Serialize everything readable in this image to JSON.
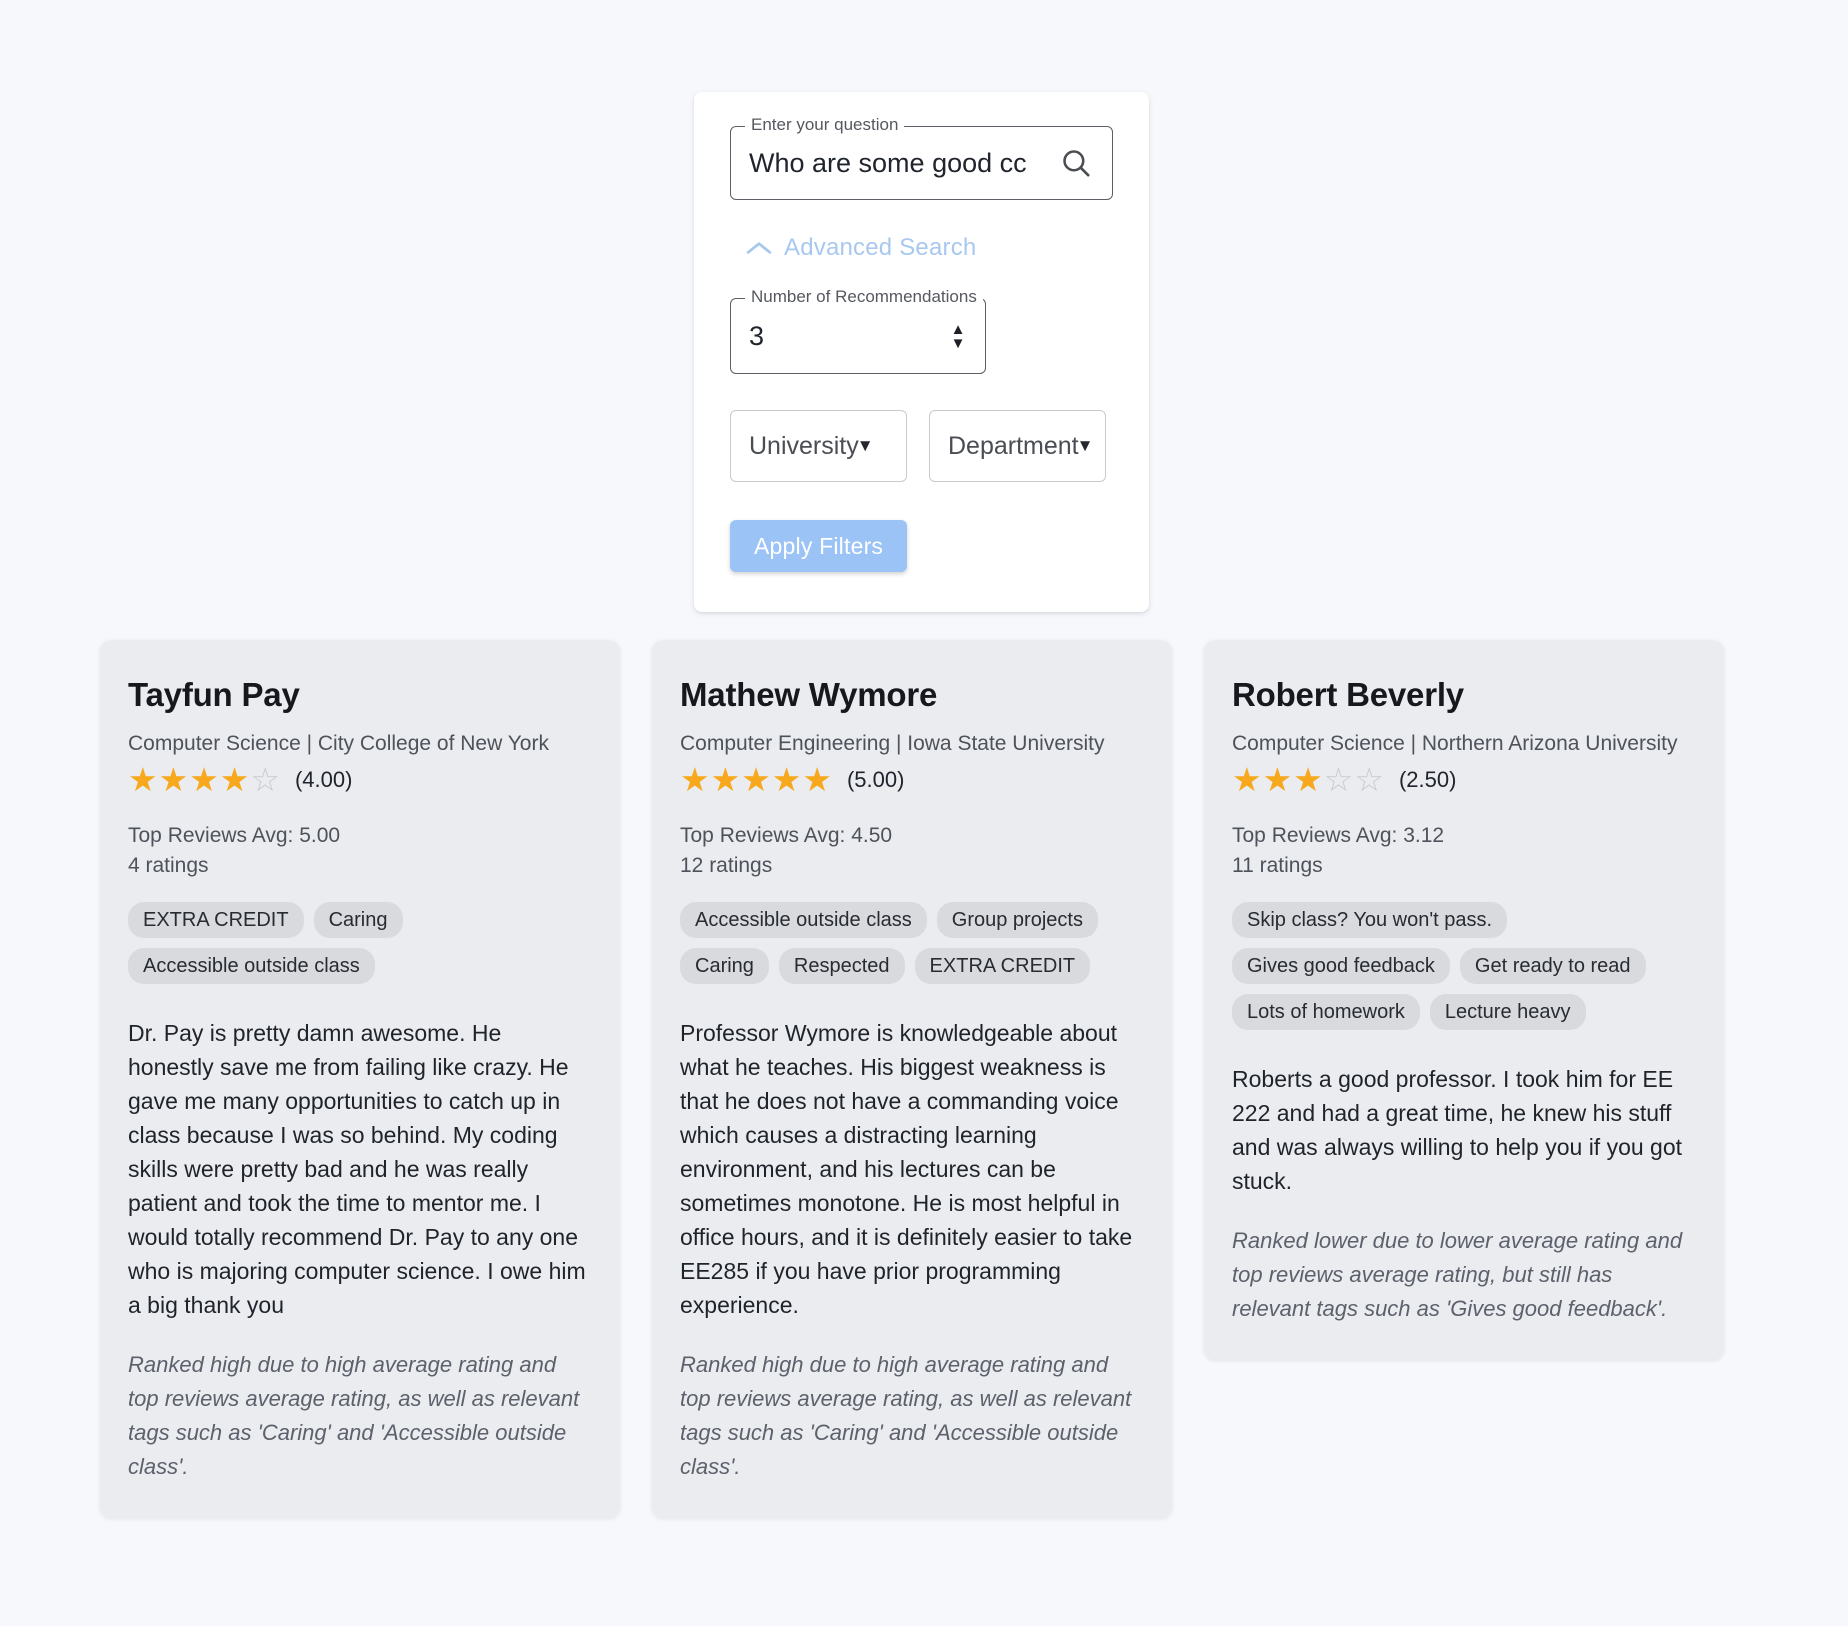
{
  "search": {
    "question_legend": "Enter your question",
    "question_value": "Who are some good cc",
    "question_placeholder": "Enter your question",
    "search_icon": "search-icon",
    "advanced_toggle_label": "Advanced Search",
    "advanced_toggle_icon": "chevron-up-icon",
    "recommendations_legend": "Number of Recommendations",
    "recommendations_value": "3",
    "spinner_up_icon": "chevron-up-icon",
    "spinner_down_icon": "chevron-down-icon",
    "university_select": "University",
    "department_select": "Department",
    "select_caret_icon": "caret-down-icon",
    "apply_button": "Apply Filters",
    "accent_color": "#9cc3f5",
    "link_color": "#a9c8ef"
  },
  "results": [
    {
      "name": "Tayfun Pay",
      "subtitle": "Computer Science | City College of New York",
      "stars_full": 4,
      "stars_empty": 1,
      "rating_text": "(4.00)",
      "top_reviews_avg": "Top Reviews Avg: 5.00",
      "ratings_count": "4 ratings",
      "tags": [
        "EXTRA CREDIT",
        "Caring",
        "Accessible outside class"
      ],
      "review": "Dr. Pay is pretty damn awesome. He honestly save me from failing like crazy. He gave me many opportunities to catch up in class because I was so behind. My coding skills were pretty bad and he was really patient and took the time to mentor me. I would totally recommend Dr. Pay to any one who is majoring computer science. I owe him a big thank you",
      "rank_note": "Ranked high due to high average rating and top reviews average rating, as well as relevant tags such as 'Caring' and 'Accessible outside class'."
    },
    {
      "name": "Mathew Wymore",
      "subtitle": "Computer Engineering | Iowa State University",
      "stars_full": 5,
      "stars_empty": 0,
      "rating_text": "(5.00)",
      "top_reviews_avg": "Top Reviews Avg: 4.50",
      "ratings_count": "12 ratings",
      "tags": [
        "Accessible outside class",
        "Group projects",
        "Caring",
        "Respected",
        "EXTRA CREDIT"
      ],
      "review": "Professor Wymore is knowledgeable about what he teaches. His biggest weakness is that he does not have a commanding voice which causes a distracting learning environment, and his lectures can be sometimes monotone. He is most helpful in office hours, and it is definitely easier to take EE285 if you have prior programming experience.",
      "rank_note": "Ranked high due to high average rating and top reviews average rating, as well as relevant tags such as 'Caring' and 'Accessible outside class'."
    },
    {
      "name": "Robert Beverly",
      "subtitle": "Computer Science | Northern Arizona University",
      "stars_full": 3,
      "stars_empty": 2,
      "rating_text": "(2.50)",
      "top_reviews_avg": "Top Reviews Avg: 3.12",
      "ratings_count": "11 ratings",
      "tags": [
        "Skip class? You won't pass.",
        "Gives good feedback",
        "Get ready to read",
        "Lots of homework",
        "Lecture heavy"
      ],
      "review": "Roberts a good professor. I took him for EE 222 and had a great time, he knew his stuff and was always willing to help you if you got stuck.",
      "rank_note": "Ranked lower due to lower average rating and top reviews average rating, but still has relevant tags such as 'Gives good feedback'."
    }
  ]
}
